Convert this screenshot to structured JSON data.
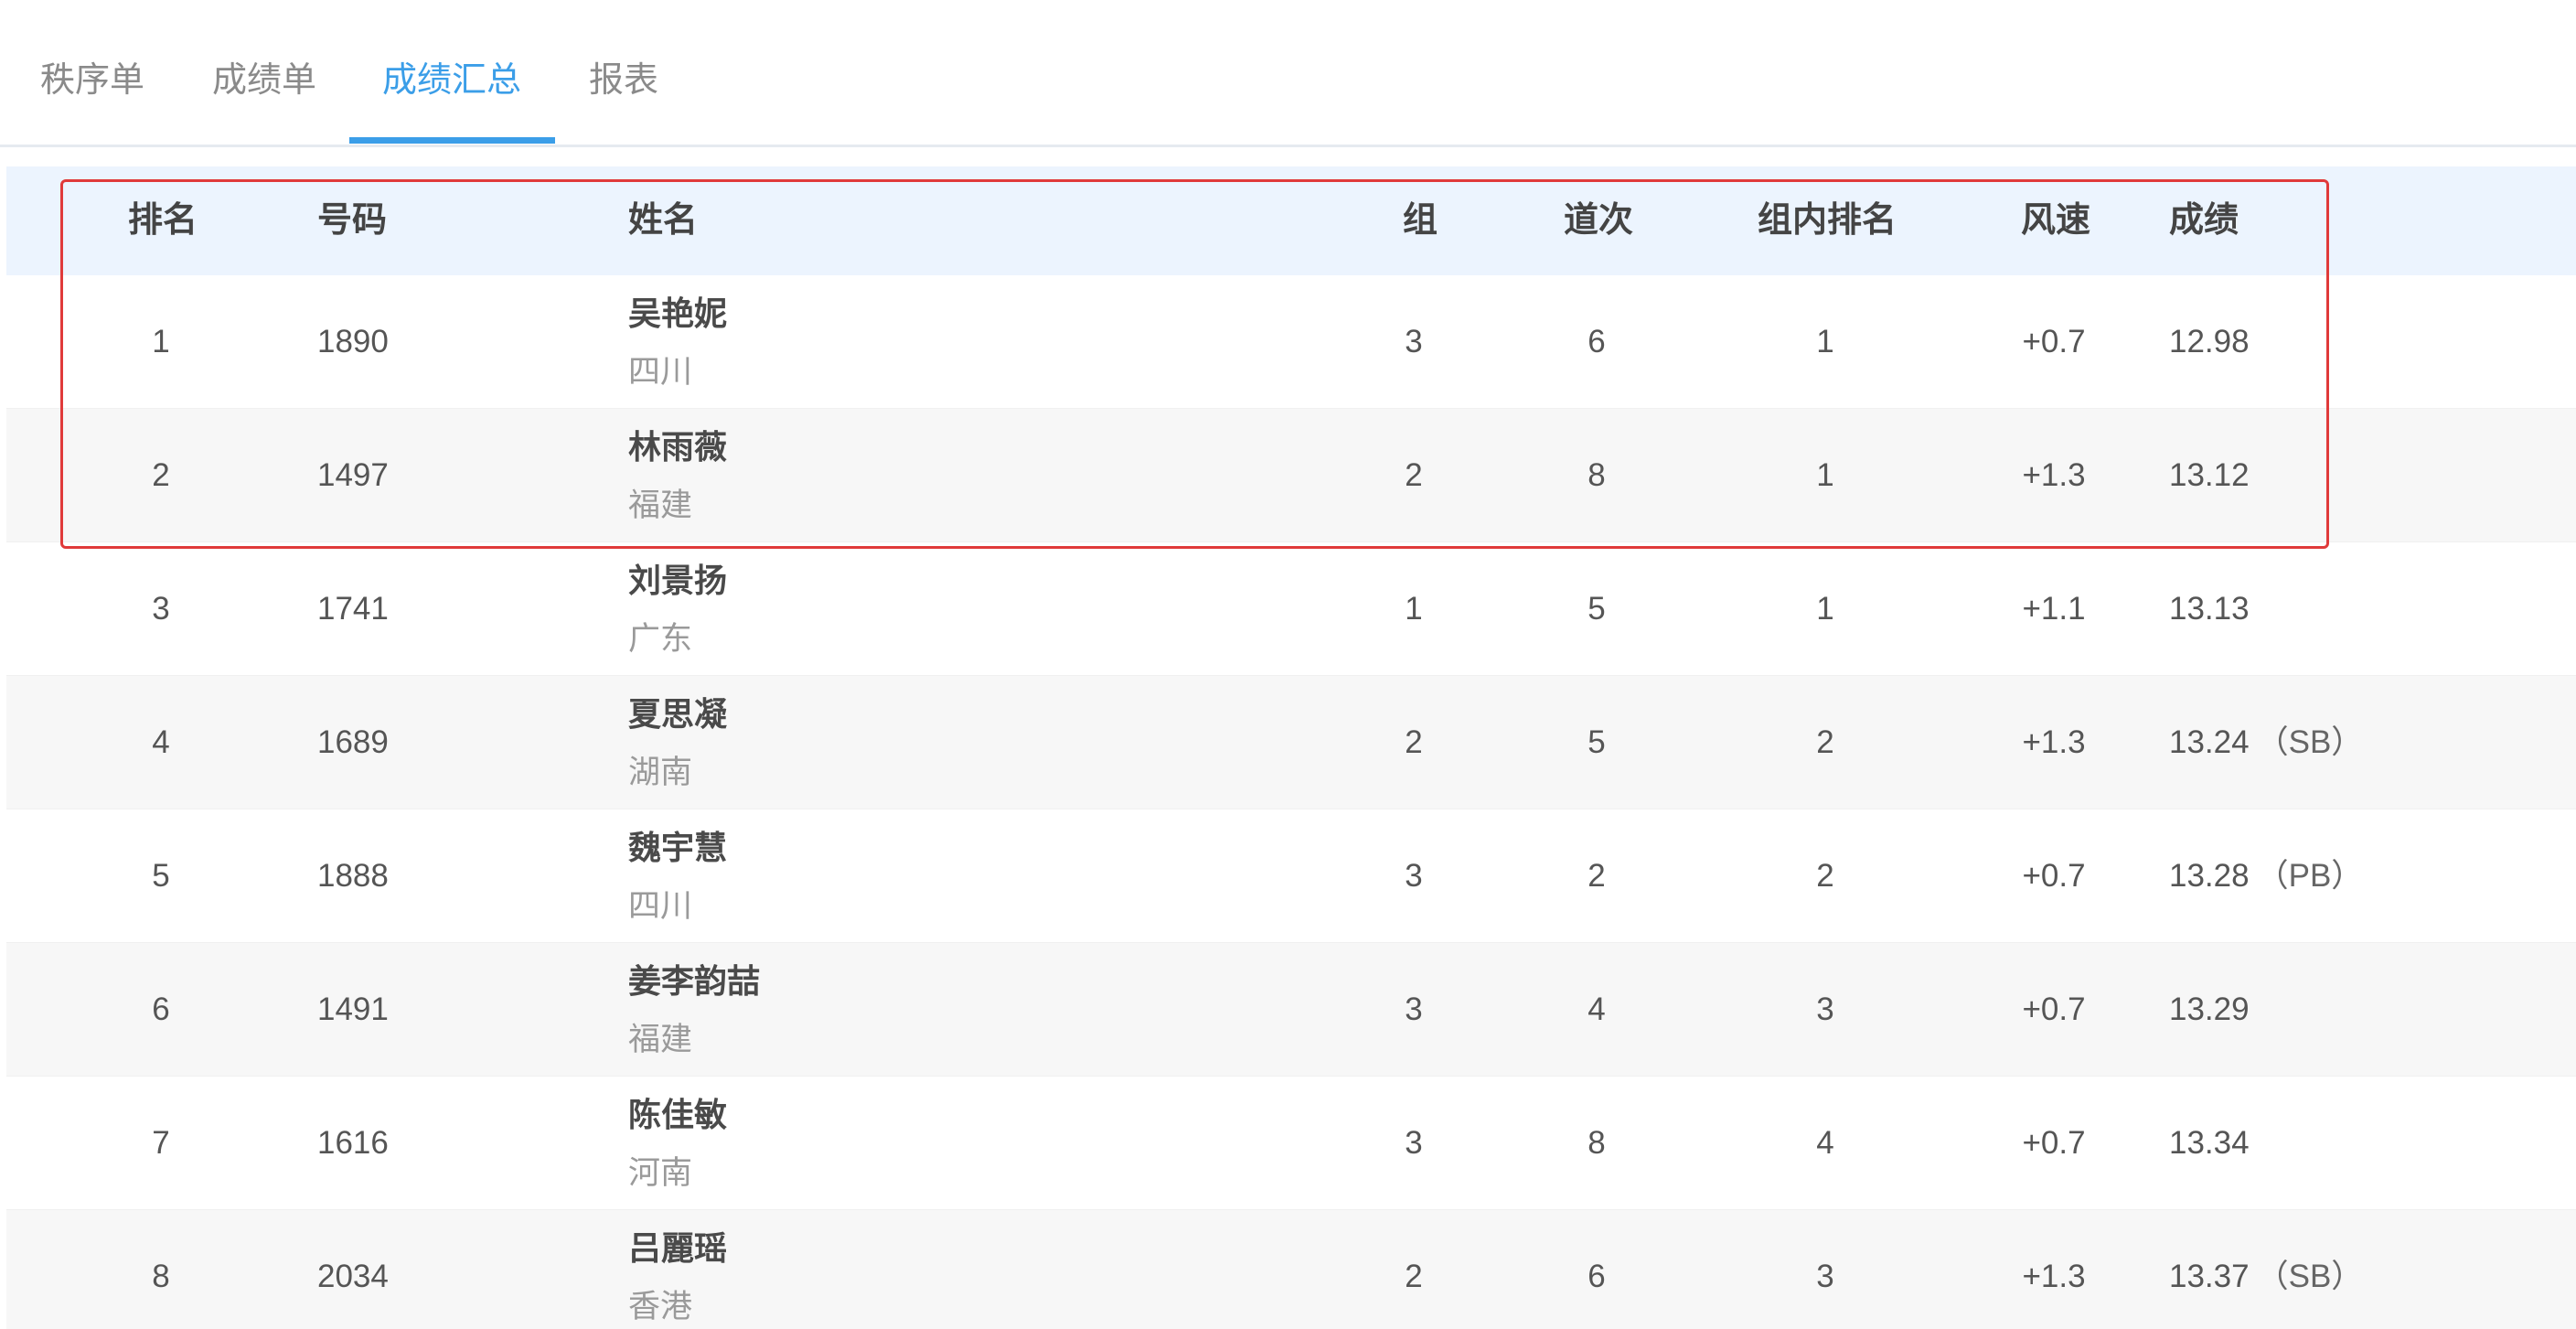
{
  "tabs": [
    {
      "label": "秩序单",
      "active": false
    },
    {
      "label": "成绩单",
      "active": false
    },
    {
      "label": "成绩汇总",
      "active": true
    },
    {
      "label": "报表",
      "active": false
    }
  ],
  "colors": {
    "accent": "#3b9ee8",
    "header_bg": "#ecf4fe",
    "alt_row_bg": "#f7f7f7",
    "highlight_border": "#e03a3a"
  },
  "table": {
    "headers": [
      "排名",
      "号码",
      "姓名",
      "组",
      "道次",
      "组内排名",
      "风速",
      "成绩"
    ],
    "rows": [
      {
        "rank": "1",
        "number": "1890",
        "name": "吴艳妮",
        "region": "四川",
        "group": "3",
        "lane": "6",
        "group_rank": "1",
        "wind": "+0.7",
        "result": "12.98",
        "tag": ""
      },
      {
        "rank": "2",
        "number": "1497",
        "name": "林雨薇",
        "region": "福建",
        "group": "2",
        "lane": "8",
        "group_rank": "1",
        "wind": "+1.3",
        "result": "13.12",
        "tag": ""
      },
      {
        "rank": "3",
        "number": "1741",
        "name": "刘景扬",
        "region": "广东",
        "group": "1",
        "lane": "5",
        "group_rank": "1",
        "wind": "+1.1",
        "result": "13.13",
        "tag": ""
      },
      {
        "rank": "4",
        "number": "1689",
        "name": "夏思凝",
        "region": "湖南",
        "group": "2",
        "lane": "5",
        "group_rank": "2",
        "wind": "+1.3",
        "result": "13.24",
        "tag": "（SB）"
      },
      {
        "rank": "5",
        "number": "1888",
        "name": "魏宇慧",
        "region": "四川",
        "group": "3",
        "lane": "2",
        "group_rank": "2",
        "wind": "+0.7",
        "result": "13.28",
        "tag": "（PB）"
      },
      {
        "rank": "6",
        "number": "1491",
        "name": "姜李韵喆",
        "region": "福建",
        "group": "3",
        "lane": "4",
        "group_rank": "3",
        "wind": "+0.7",
        "result": "13.29",
        "tag": ""
      },
      {
        "rank": "7",
        "number": "1616",
        "name": "陈佳敏",
        "region": "河南",
        "group": "3",
        "lane": "8",
        "group_rank": "4",
        "wind": "+0.7",
        "result": "13.34",
        "tag": ""
      },
      {
        "rank": "8",
        "number": "2034",
        "name": "吕麗瑶",
        "region": "香港",
        "group": "2",
        "lane": "6",
        "group_rank": "3",
        "wind": "+1.3",
        "result": "13.37",
        "tag": "（SB）"
      }
    ]
  }
}
